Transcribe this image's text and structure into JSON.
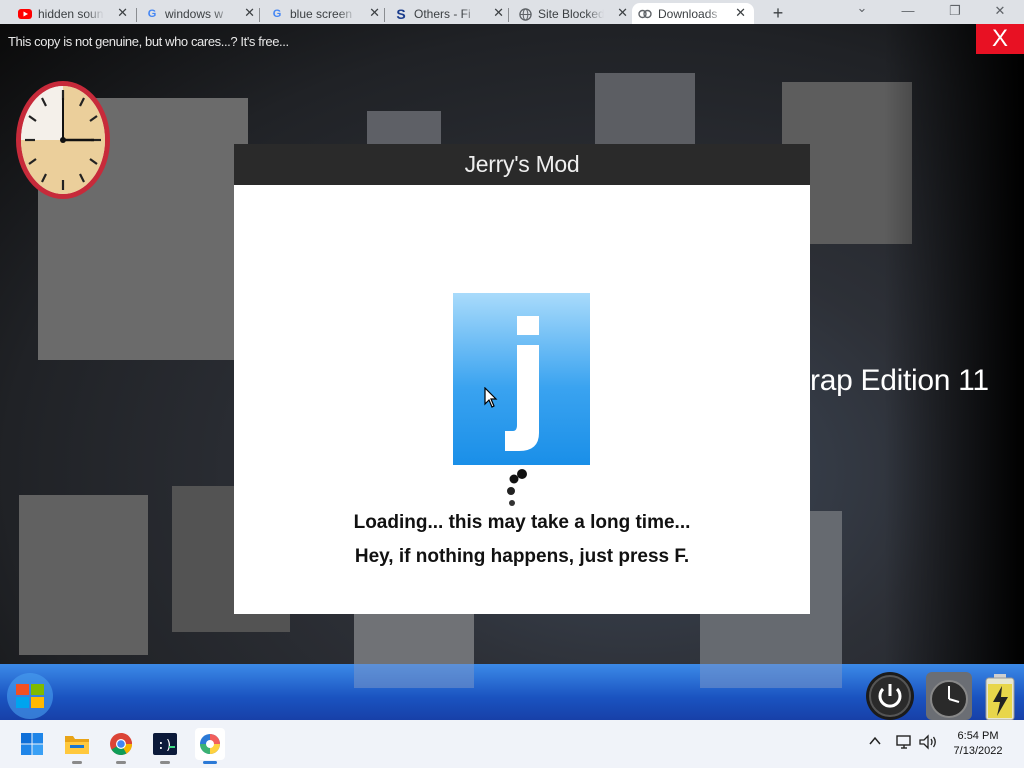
{
  "browser": {
    "tabs": [
      {
        "label": "hidden sounds",
        "icon": "youtube-icon"
      },
      {
        "label": "windows w",
        "icon": "google-icon"
      },
      {
        "label": "blue screen",
        "icon": "google-icon"
      },
      {
        "label": "Others - Fi",
        "icon": "s-logo-icon"
      },
      {
        "label": "Site Blocked",
        "icon": "globe-icon"
      },
      {
        "label": "Downloads",
        "icon": "downloads-icon",
        "active": true
      }
    ],
    "new_tab": "+",
    "close_tab": "✕",
    "minimize": "—",
    "restore": "❐",
    "close": "✕",
    "dropdown": "⌄"
  },
  "desktop": {
    "watermark": "This copy is not genuine, but who cares...? It's free...",
    "close_x": "X",
    "edition_text": "rap Edition 11"
  },
  "dialog": {
    "title": "Jerry's Mod",
    "logo_letter": "j",
    "line1": "Loading... this may take a long time...",
    "line2": "Hey, if nothing happens, just press F."
  },
  "taskbar": {
    "time": "6:54 PM",
    "date": "7/13/2022",
    "apps": [
      "windows-start-icon",
      "file-explorer-icon",
      "chrome-icon",
      "terminal-icon",
      "app-icon"
    ],
    "tray": [
      "chevron-up-icon",
      "network-icon",
      "volume-icon"
    ]
  },
  "colors": {
    "close_red": "#e81123",
    "dialog_title_bg": "#2a2a2a",
    "logo_blue": "#3aa3f0",
    "taskbar_blue": "#1a53c0"
  }
}
